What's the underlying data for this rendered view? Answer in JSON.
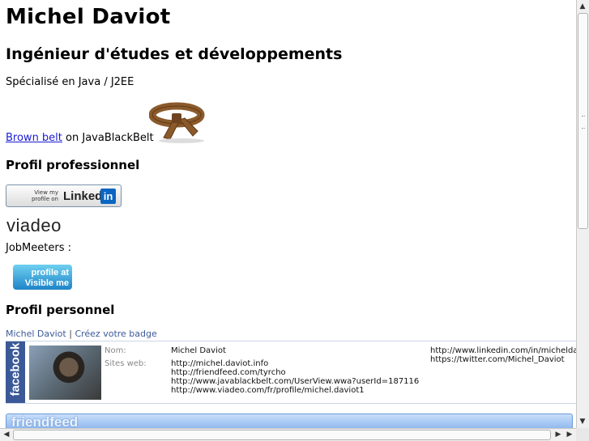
{
  "header": {
    "name": "Michel Daviot",
    "title": "Ingénieur d'études et développements",
    "specialty": "Spécialisé en Java / J2EE"
  },
  "belt": {
    "link_text": "Brown belt",
    "suffix": " on JavaBlackBelt",
    "color": "#8b5a2b"
  },
  "sections": {
    "professional": "Profil professionnel",
    "personal": "Profil personnel"
  },
  "linkedin": {
    "small_text_1": "View my",
    "small_text_2": "profile on",
    "word": "Linked",
    "in": "in",
    "brand_color": "#0a66c2"
  },
  "viadeo": {
    "logo": "viadeo"
  },
  "jobmeeters": {
    "label": "JobMeeters :"
  },
  "visibleme": {
    "line1": "profile at",
    "line2": "Visible me"
  },
  "facebook_badge": {
    "name_link": "Michel Daviot",
    "separator": "|",
    "create_link": "Créez votre badge",
    "side_text": "facebook",
    "brand_color": "#3b5998",
    "fields": {
      "name_label": "Nom:",
      "name_value": "Michel Daviot",
      "sites_label": "Sites web:",
      "sites": [
        "http://michel.daviot.info",
        "http://friendfeed.com/tyrcho",
        "http://www.javablackbelt.com/UserView.wwa?userId=187116",
        "http://www.viadeo.com/fr/profile/michel.daviot1"
      ],
      "sites_right": [
        "http://www.linkedin.com/in/micheldaviot",
        "https://twitter.com/Michel_Daviot"
      ]
    }
  },
  "friendfeed": {
    "logo": "friendfeed"
  },
  "scrollbars": {
    "up_icon": "▲",
    "down_icon": "▼",
    "left_icon": "◀",
    "right_icon": "▶"
  }
}
